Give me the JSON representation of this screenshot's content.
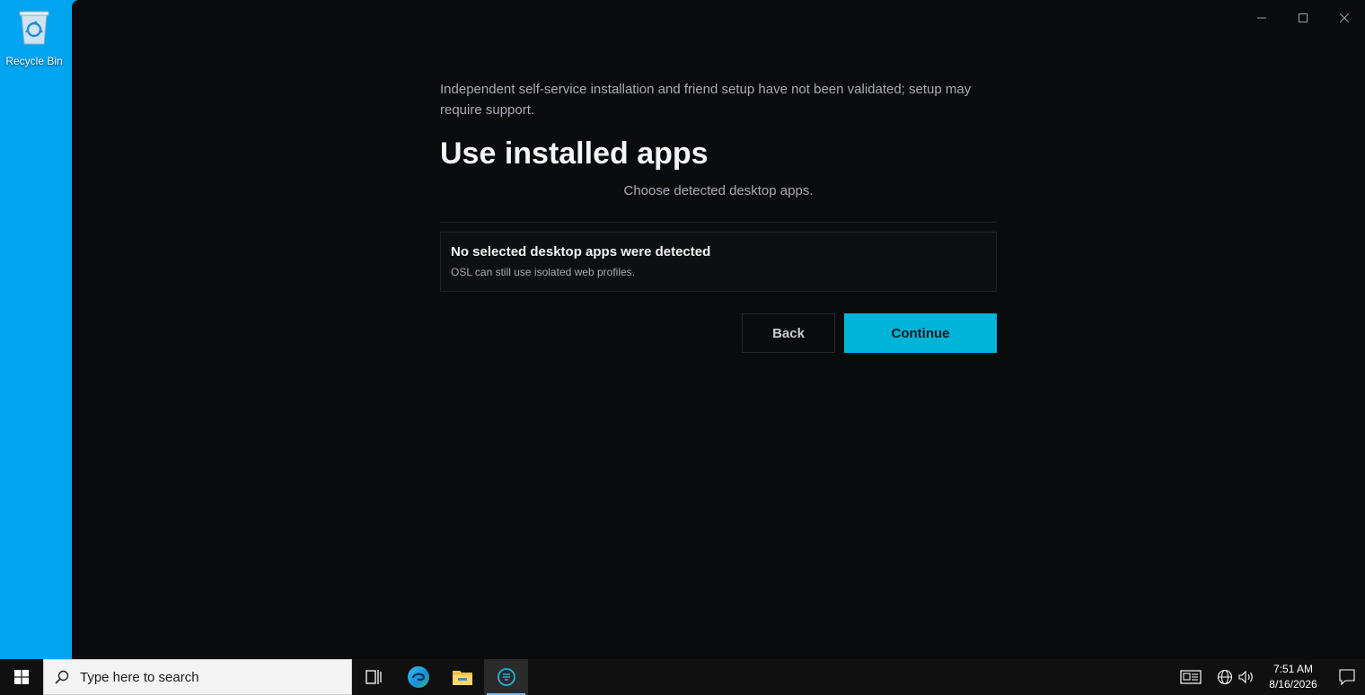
{
  "desktop": {
    "recycle_bin_label": "Recycle Bin"
  },
  "window": {
    "notice": "Independent self-service installation and friend setup have not been validated; setup may require support.",
    "title": "Use installed apps",
    "subtitle": "Choose detected desktop apps.",
    "card": {
      "title": "No selected desktop apps were detected",
      "subtitle": "OSL can still use isolated web profiles."
    },
    "buttons": {
      "back": "Back",
      "continue": "Continue"
    },
    "accent_color": "#00b4d8"
  },
  "taskbar": {
    "search_placeholder": "Type here to search",
    "time": "7:51 AM",
    "date": "8/16/2026",
    "pinned": [
      "task-view-icon",
      "edge-icon",
      "file-explorer-icon",
      "osl-app-icon"
    ]
  }
}
